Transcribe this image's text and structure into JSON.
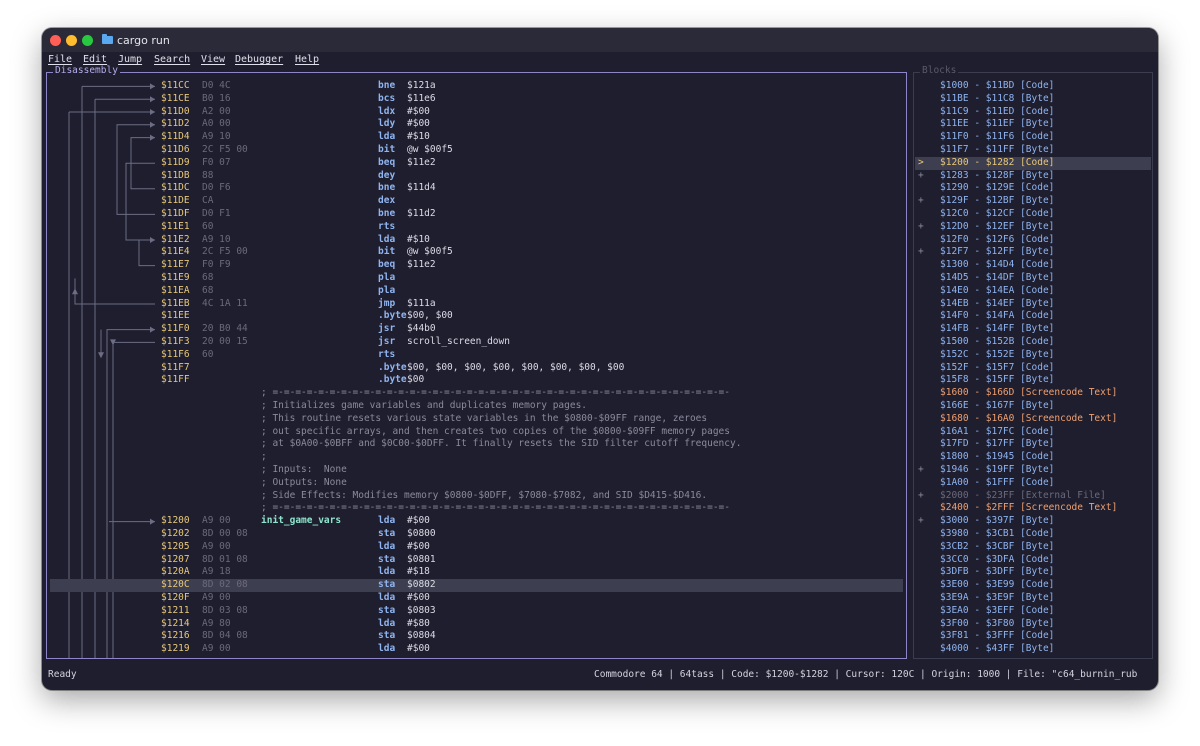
{
  "window": {
    "title": "cargo run"
  },
  "menu": [
    "File",
    "Edit",
    "Jump",
    "Search",
    "View",
    "Debugger",
    "Help"
  ],
  "disassembly": {
    "title": "Disassembly",
    "lines": [
      {
        "addr": "$11CC",
        "bytes": "D0 4C",
        "mn": "bne",
        "op": "$121a"
      },
      {
        "addr": "$11CE",
        "bytes": "B0 16",
        "mn": "bcs",
        "op": "$11e6"
      },
      {
        "addr": "$11D0",
        "bytes": "A2 00",
        "mn": "ldx",
        "op": "#$00"
      },
      {
        "addr": "$11D2",
        "bytes": "A0 00",
        "mn": "ldy",
        "op": "#$00"
      },
      {
        "addr": "$11D4",
        "bytes": "A9 10",
        "mn": "lda",
        "op": "#$10"
      },
      {
        "addr": "$11D6",
        "bytes": "2C F5 00",
        "mn": "bit",
        "op": "@w $00f5"
      },
      {
        "addr": "$11D9",
        "bytes": "F0 07",
        "mn": "beq",
        "op": "$11e2"
      },
      {
        "addr": "$11DB",
        "bytes": "88",
        "mn": "dey",
        "op": ""
      },
      {
        "addr": "$11DC",
        "bytes": "D0 F6",
        "mn": "bne",
        "op": "$11d4"
      },
      {
        "addr": "$11DE",
        "bytes": "CA",
        "mn": "dex",
        "op": ""
      },
      {
        "addr": "$11DF",
        "bytes": "D0 F1",
        "mn": "bne",
        "op": "$11d2"
      },
      {
        "addr": "$11E1",
        "bytes": "60",
        "mn": "rts",
        "op": ""
      },
      {
        "addr": "$11E2",
        "bytes": "A9 10",
        "mn": "lda",
        "op": "#$10"
      },
      {
        "addr": "$11E4",
        "bytes": "2C F5 00",
        "mn": "bit",
        "op": "@w $00f5"
      },
      {
        "addr": "$11E7",
        "bytes": "F0 F9",
        "mn": "beq",
        "op": "$11e2"
      },
      {
        "addr": "$11E9",
        "bytes": "68",
        "mn": "pla",
        "op": ""
      },
      {
        "addr": "$11EA",
        "bytes": "68",
        "mn": "pla",
        "op": ""
      },
      {
        "addr": "$11EB",
        "bytes": "4C 1A 11",
        "mn": "jmp",
        "op": "$111a"
      },
      {
        "addr": "$11EE",
        "bytes": "",
        "mn": ".byte",
        "op": "$00, $00"
      },
      {
        "addr": "$11F0",
        "bytes": "20 B0 44",
        "mn": "jsr",
        "op": "$44b0"
      },
      {
        "addr": "$11F3",
        "bytes": "20 00 15",
        "mn": "jsr",
        "op": "scroll_screen_down"
      },
      {
        "addr": "$11F6",
        "bytes": "60",
        "mn": "rts",
        "op": ""
      },
      {
        "addr": "$11F7",
        "bytes": "",
        "mn": ".byte",
        "op": "$00, $00, $00, $00, $00, $00, $00, $00"
      },
      {
        "addr": "$11FF",
        "bytes": "",
        "mn": ".byte",
        "op": "$00"
      },
      {
        "comment": "; =-=-=-=-=-=-=-=-=-=-=-=-=-=-=-=-=-=-=-=-=-=-=-=-=-=-=-=-=-=-=-=-=-=-=-=-=-=-=-=-"
      },
      {
        "comment": "; Initializes game variables and duplicates memory pages."
      },
      {
        "comment": "; This routine resets various state variables in the $0800-$09FF range, zeroes"
      },
      {
        "comment": "; out specific arrays, and then creates two copies of the $0800-$09FF memory pages"
      },
      {
        "comment": "; at $0A00-$0BFF and $0C00-$0DFF. It finally resets the SID filter cutoff frequency."
      },
      {
        "comment": ";"
      },
      {
        "comment": "; Inputs:  None"
      },
      {
        "comment": "; Outputs: None"
      },
      {
        "comment": "; Side Effects: Modifies memory $0800-$0DFF, $7080-$7082, and SID $D415-$D416."
      },
      {
        "comment": "; =-=-=-=-=-=-=-=-=-=-=-=-=-=-=-=-=-=-=-=-=-=-=-=-=-=-=-=-=-=-=-=-=-=-=-=-=-=-=-=-"
      },
      {
        "addr": "$1200",
        "bytes": "A9 00",
        "label": "init_game_vars",
        "mn": "lda",
        "op": "#$00"
      },
      {
        "addr": "$1202",
        "bytes": "8D 00 08",
        "mn": "sta",
        "op": "$0800"
      },
      {
        "addr": "$1205",
        "bytes": "A9 00",
        "mn": "lda",
        "op": "#$00"
      },
      {
        "addr": "$1207",
        "bytes": "8D 01 08",
        "mn": "sta",
        "op": "$0801"
      },
      {
        "addr": "$120A",
        "bytes": "A9 18",
        "mn": "lda",
        "op": "#$18"
      },
      {
        "addr": "$120C",
        "bytes": "8D 02 08",
        "mn": "sta",
        "op": "$0802",
        "selected": true
      },
      {
        "addr": "$120F",
        "bytes": "A9 00",
        "mn": "lda",
        "op": "#$00"
      },
      {
        "addr": "$1211",
        "bytes": "8D 03 08",
        "mn": "sta",
        "op": "$0803"
      },
      {
        "addr": "$1214",
        "bytes": "A9 80",
        "mn": "lda",
        "op": "#$80"
      },
      {
        "addr": "$1216",
        "bytes": "8D 04 08",
        "mn": "sta",
        "op": "$0804"
      },
      {
        "addr": "$1219",
        "bytes": "A9 00",
        "mn": "lda",
        "op": "#$00"
      }
    ]
  },
  "blocks": {
    "title": "Blocks",
    "items": [
      {
        "mark": "",
        "text": "$1000 - $11BD [Code]",
        "kind": "code"
      },
      {
        "mark": "",
        "text": "$11BE - $11C8 [Byte]",
        "kind": "code"
      },
      {
        "mark": "",
        "text": "$11C9 - $11ED [Code]",
        "kind": "code"
      },
      {
        "mark": "",
        "text": "$11EE - $11EF [Byte]",
        "kind": "code"
      },
      {
        "mark": "",
        "text": "$11F0 - $11F6 [Code]",
        "kind": "code"
      },
      {
        "mark": "",
        "text": "$11F7 - $11FF [Byte]",
        "kind": "code"
      },
      {
        "mark": ">",
        "text": "$1200 - $1282 [Code]",
        "kind": "selected"
      },
      {
        "mark": "+",
        "text": "$1283 - $128F [Byte]",
        "kind": "code"
      },
      {
        "mark": "",
        "text": "$1290 - $129E [Code]",
        "kind": "code"
      },
      {
        "mark": "+",
        "text": "$129F - $12BF [Byte]",
        "kind": "code"
      },
      {
        "mark": "",
        "text": "$12C0 - $12CF [Code]",
        "kind": "code"
      },
      {
        "mark": "+",
        "text": "$12D0 - $12EF [Byte]",
        "kind": "code"
      },
      {
        "mark": "",
        "text": "$12F0 - $12F6 [Code]",
        "kind": "code"
      },
      {
        "mark": "+",
        "text": "$12F7 - $12FF [Byte]",
        "kind": "code"
      },
      {
        "mark": "",
        "text": "$1300 - $14D4 [Code]",
        "kind": "code"
      },
      {
        "mark": "",
        "text": "$14D5 - $14DF [Byte]",
        "kind": "code"
      },
      {
        "mark": "",
        "text": "$14E0 - $14EA [Code]",
        "kind": "code"
      },
      {
        "mark": "",
        "text": "$14EB - $14EF [Byte]",
        "kind": "code"
      },
      {
        "mark": "",
        "text": "$14F0 - $14FA [Code]",
        "kind": "code"
      },
      {
        "mark": "",
        "text": "$14FB - $14FF [Byte]",
        "kind": "code"
      },
      {
        "mark": "",
        "text": "$1500 - $152B [Code]",
        "kind": "code"
      },
      {
        "mark": "",
        "text": "$152C - $152E [Byte]",
        "kind": "code"
      },
      {
        "mark": "",
        "text": "$152F - $15F7 [Code]",
        "kind": "code"
      },
      {
        "mark": "",
        "text": "$15F8 - $15FF [Byte]",
        "kind": "code"
      },
      {
        "mark": "",
        "text": "$1600 - $166D [Screencode Text]",
        "kind": "screen"
      },
      {
        "mark": "",
        "text": "$166E - $167F [Byte]",
        "kind": "code"
      },
      {
        "mark": "",
        "text": "$1680 - $16A0 [Screencode Text]",
        "kind": "screen"
      },
      {
        "mark": "",
        "text": "$16A1 - $17FC [Code]",
        "kind": "code"
      },
      {
        "mark": "",
        "text": "$17FD - $17FF [Byte]",
        "kind": "code"
      },
      {
        "mark": "",
        "text": "$1800 - $1945 [Code]",
        "kind": "code"
      },
      {
        "mark": "+",
        "text": "$1946 - $19FF [Byte]",
        "kind": "code"
      },
      {
        "mark": "",
        "text": "$1A00 - $1FFF [Code]",
        "kind": "code"
      },
      {
        "mark": "+",
        "text": "$2000 - $23FF [External File]",
        "kind": "external"
      },
      {
        "mark": "",
        "text": "$2400 - $2FFF [Screencode Text]",
        "kind": "screen"
      },
      {
        "mark": "+",
        "text": "$3000 - $397F [Byte]",
        "kind": "code"
      },
      {
        "mark": "",
        "text": "$3980 - $3CB1 [Code]",
        "kind": "code"
      },
      {
        "mark": "",
        "text": "$3CB2 - $3CBF [Byte]",
        "kind": "code"
      },
      {
        "mark": "",
        "text": "$3CC0 - $3DFA [Code]",
        "kind": "code"
      },
      {
        "mark": "",
        "text": "$3DFB - $3DFF [Byte]",
        "kind": "code"
      },
      {
        "mark": "",
        "text": "$3E00 - $3E99 [Code]",
        "kind": "code"
      },
      {
        "mark": "",
        "text": "$3E9A - $3E9F [Byte]",
        "kind": "code"
      },
      {
        "mark": "",
        "text": "$3EA0 - $3EFF [Code]",
        "kind": "code"
      },
      {
        "mark": "",
        "text": "$3F00 - $3F80 [Byte]",
        "kind": "code"
      },
      {
        "mark": "",
        "text": "$3F81 - $3FFF [Code]",
        "kind": "code"
      },
      {
        "mark": "",
        "text": "$4000 - $43FF [Byte]",
        "kind": "code"
      }
    ]
  },
  "status": {
    "left": "Ready",
    "right": "Commodore 64 | 64tass | Code: $1200-$1282 | Cursor: 120C | Origin: 1000 | File: \"c64_burnin_rub"
  },
  "colors": {
    "code": "#8fb4f0",
    "screen": "#f0a070",
    "external": "#6a6a7c",
    "selected": "#e8c878",
    "selected_bg": "#3d3e50",
    "panel_border": "#8f84c8"
  }
}
